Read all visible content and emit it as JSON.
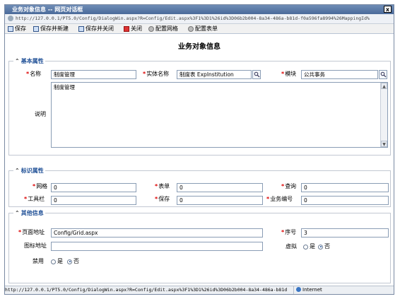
{
  "window": {
    "title": "业务对象信息 -- 网页对话框",
    "close": "x"
  },
  "address": {
    "url": "http://127.0.0.1/PT5.0/Config/DialogWin.aspx?R=Config/Edit.aspx%3F1%3D1%26id%3D06b2b004-8a34-486a-b81d-f0a596fa8994%26MappingId%"
  },
  "toolbar": {
    "save": "保存",
    "save_new": "保存并新建",
    "save_close": "保存并关闭",
    "close": "关闭",
    "config_grid": "配置网格",
    "config_form": "配置表单"
  },
  "page_title": "业务对象信息",
  "basic": {
    "legend": "基本属性",
    "name_label": "名称",
    "name_value": "制度管理",
    "entity_label": "实体名称",
    "entity_value": "制度表 ExpInstitution",
    "module_label": "模块",
    "module_value": "公共事务",
    "desc_label": "说明",
    "desc_value": "制度管理"
  },
  "ident": {
    "legend": "标识属性",
    "grid_label": "网格",
    "grid_value": "0",
    "form_label": "表单",
    "form_value": "0",
    "query_label": "查询",
    "query_value": "0",
    "toolbar_label": "工具栏",
    "toolbar_value": "0",
    "save_label": "保存",
    "save_value": "0",
    "bizno_label": "业务编号",
    "bizno_value": "0"
  },
  "other": {
    "legend": "其他信息",
    "url_label": "页面地址",
    "url_value": "Config/Grid.aspx",
    "seq_label": "序号",
    "seq_value": "3",
    "icon_label": "图标地址",
    "icon_value": "",
    "virtual_label": "虚拟",
    "yes": "是",
    "no": "否",
    "disabled_label": "禁用",
    "virtual_selected": "否",
    "disabled_selected": "否"
  },
  "status": {
    "url": "http://127.0.0.1/PT5.0/Config/DialogWin.aspx?R=Config/Edit.aspx%3F1%3D1%26id%3D06b2b004-8a34-486a-b81d",
    "zone": "Internet"
  }
}
